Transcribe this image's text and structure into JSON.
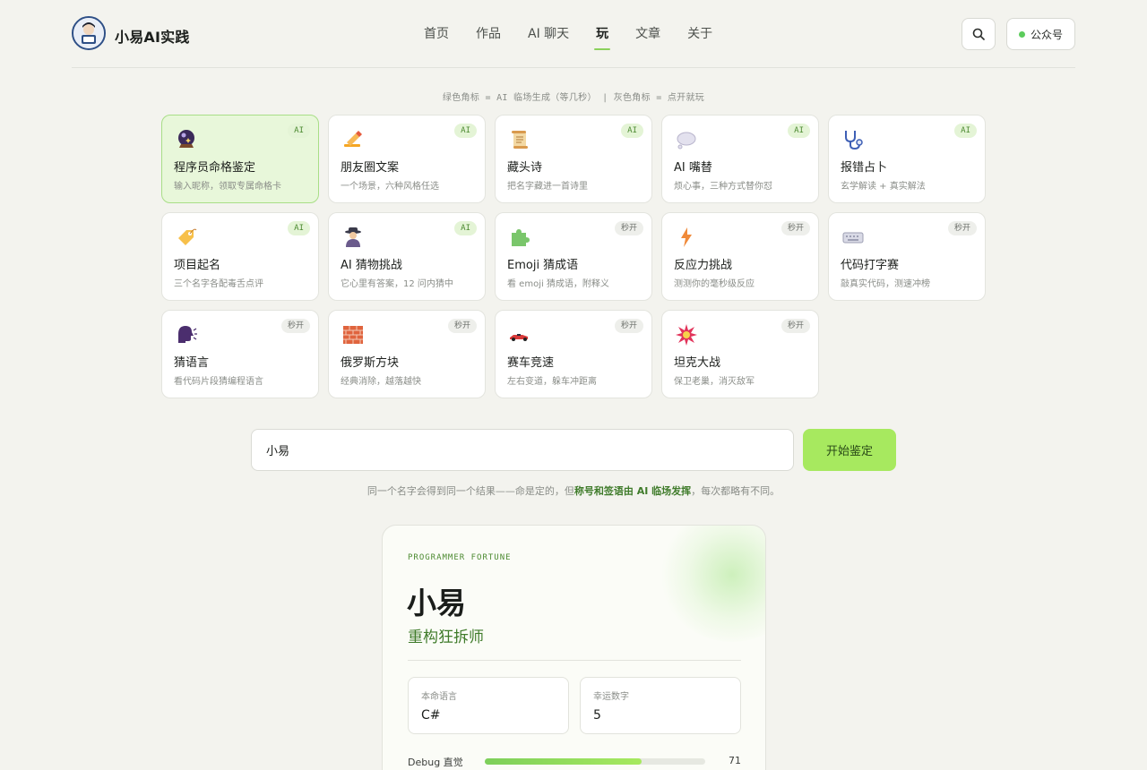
{
  "brand": {
    "name": "小易AI实践"
  },
  "nav": {
    "items": [
      "首页",
      "作品",
      "AI 聊天",
      "玩",
      "文章",
      "关于"
    ],
    "active": "玩"
  },
  "header": {
    "gzh_label": "公众号",
    "search_icon": "search-icon"
  },
  "legend": "绿色角标 = AI 临场生成（等几秒） | 灰色角标 = 点开就玩",
  "cards": [
    {
      "title": "程序员命格鉴定",
      "desc": "输入昵称，领取专属命格卡",
      "badge": "AI",
      "icon": "crystal-ball-icon",
      "selected": true
    },
    {
      "title": "朋友圈文案",
      "desc": "一个场景，六种风格任选",
      "badge": "AI",
      "icon": "writing-hand-icon"
    },
    {
      "title": "藏头诗",
      "desc": "把名字藏进一首诗里",
      "badge": "AI",
      "icon": "scroll-icon"
    },
    {
      "title": "AI 嘴替",
      "desc": "烦心事，三种方式替你怼",
      "badge": "AI",
      "icon": "speech-bubble-icon"
    },
    {
      "title": "报错占卜",
      "desc": "玄学解读 + 真实解法",
      "badge": "AI",
      "icon": "stethoscope-icon"
    },
    {
      "title": "项目起名",
      "desc": "三个名字各配毒舌点评",
      "badge": "AI",
      "icon": "tag-icon"
    },
    {
      "title": "AI 猜物挑战",
      "desc": "它心里有答案，12 问内猜中",
      "badge": "AI",
      "icon": "detective-icon"
    },
    {
      "title": "Emoji 猜成语",
      "desc": "看 emoji 猜成语，附释义",
      "badge": "秒开",
      "icon": "puzzle-icon"
    },
    {
      "title": "反应力挑战",
      "desc": "测测你的毫秒级反应",
      "badge": "秒开",
      "icon": "lightning-icon"
    },
    {
      "title": "代码打字赛",
      "desc": "敲真实代码，测速冲榜",
      "badge": "秒开",
      "icon": "keyboard-icon"
    },
    {
      "title": "猜语言",
      "desc": "看代码片段猜编程语言",
      "badge": "秒开",
      "icon": "speaking-head-icon"
    },
    {
      "title": "俄罗斯方块",
      "desc": "经典消除，越落越快",
      "badge": "秒开",
      "icon": "brick-icon"
    },
    {
      "title": "赛车竞速",
      "desc": "左右变道，躲车冲距离",
      "badge": "秒开",
      "icon": "race-car-icon"
    },
    {
      "title": "坦克大战",
      "desc": "保卫老巢，消灭敌军",
      "badge": "秒开",
      "icon": "explosion-icon"
    }
  ],
  "form": {
    "input_value": "小易",
    "start_label": "开始鉴定",
    "hint_pre": "同一个名字会得到同一个结果——命是定的，但",
    "hint_bold": "称号和签语由 AI 临场发挥",
    "hint_post": "，每次都略有不同。"
  },
  "result": {
    "kicker": "PROGRAMMER FORTUNE",
    "name": "小易",
    "title": "重构狂拆师",
    "stats": [
      {
        "label": "本命语言",
        "value": "C#"
      },
      {
        "label": "幸运数字",
        "value": "5"
      }
    ],
    "bars": [
      {
        "label": "Debug 直觉",
        "value": 71,
        "max": 100
      }
    ]
  },
  "colors": {
    "accent": "#a7e95f",
    "accent_dark": "#3f7b2a",
    "bg": "#f3f3ee"
  }
}
